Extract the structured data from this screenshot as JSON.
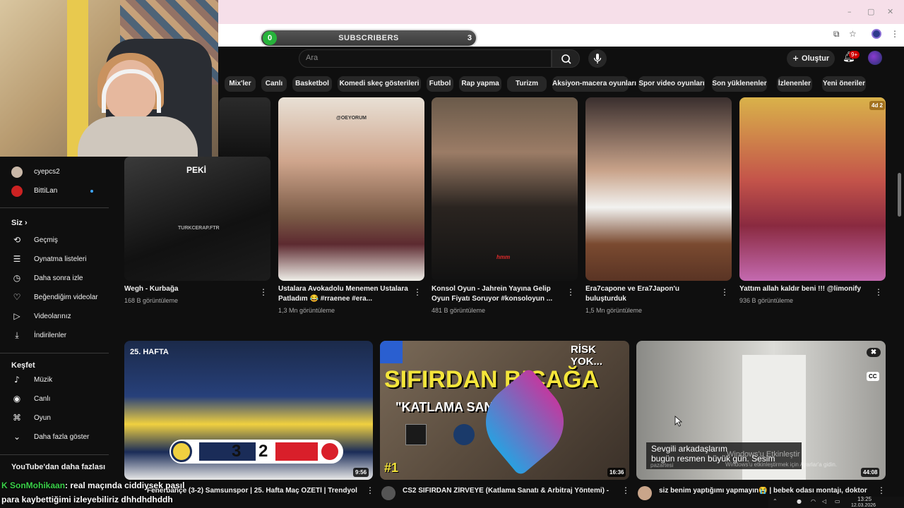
{
  "overlay": {
    "subs_current": "0",
    "subs_label": "SUBSCRIBERS",
    "subs_goal": "3"
  },
  "masthead": {
    "search_placeholder": "Ara",
    "create_label": "Oluştur",
    "notification_count": "9+"
  },
  "chips": [
    "Mix'ler",
    "Canlı",
    "Basketbol",
    "Komedi skeç gösterileri",
    "Futbol",
    "Rap yapma",
    "Turizm",
    "Aksiyon-macera oyunları",
    "Spor video oyunları",
    "Son yüklenenler",
    "İzlenenler",
    "Yeni öneriler"
  ],
  "sidebar": {
    "subscriptions": [
      {
        "label": "cyepcs2"
      },
      {
        "label": "BittiLan"
      }
    ],
    "you_header": "Siz",
    "you_items": [
      {
        "label": "Geçmiş",
        "icon": "history-icon"
      },
      {
        "label": "Oynatma listeleri",
        "icon": "playlist-icon"
      },
      {
        "label": "Daha sonra izle",
        "icon": "clock-icon"
      },
      {
        "label": "Beğendiğim videolar",
        "icon": "like-icon"
      },
      {
        "label": "Videolarınız",
        "icon": "video-icon"
      },
      {
        "label": "İndirilenler",
        "icon": "download-icon"
      }
    ],
    "explore_header": "Keşfet",
    "explore_items": [
      {
        "label": "Müzik",
        "icon": "music-icon"
      },
      {
        "label": "Canlı",
        "icon": "live-icon"
      },
      {
        "label": "Oyun",
        "icon": "gaming-icon"
      },
      {
        "label": "Daha fazla göster",
        "icon": "chevron-down-icon"
      }
    ],
    "more_header": "YouTube'dan daha fazlası"
  },
  "videos_row1": [
    {
      "title": "Wegh - Kurbağa",
      "views": "168 B görüntüleme",
      "overlay": "PEKİ",
      "watermark": "TURKCERAP.FTR"
    },
    {
      "title": "Ustalara Avokadolu Menemen Ustalara Patladım 😂 #rraenee #era...",
      "views": "1,3 Mn görüntüleme",
      "overlay": "@OEYORUM"
    },
    {
      "title": "Konsol Oyun - Jahrein Yayına Gelip Oyun Fiyatı Soruyor #konsoloyun ...",
      "views": "481 B görüntüleme",
      "overlay": "hmm"
    },
    {
      "title": "Era7capone ve Era7Japon'u buluşturduk",
      "views": "1,5 Mn görüntüleme"
    },
    {
      "title": "Yattım allah kaldır beni !!! @limonify",
      "views": "936 B görüntüleme",
      "badge": "4d 2"
    }
  ],
  "videos_row2": [
    {
      "duration": "9:56",
      "week": "25. HAFTA",
      "score_home": "3",
      "score_away": "2",
      "title": "Fenerbahçe (3-2) Samsunspor | 25. Hafta Maç ÖZETİ | Trendyol"
    },
    {
      "duration": "16:36",
      "headline": "SIFIRDAN BIÇAĞA",
      "subline": "\"KATLAMA SANATI V2\"",
      "corner": "RİSK YOK...",
      "rank": "#1",
      "title": "CS2 SIFIRDAN ZİRVEYE (Katlama Sanatı & Arbitraj Yöntemi) -"
    },
    {
      "duration": "44:08",
      "caption_line1": "Sevgili arkadaşlarım",
      "caption_line2": "bugün resmen büyük gün. Sesim",
      "cc": "CC",
      "title": "siz benim yaptığımı yapmayın😭 | bebek odası montajı, doktor"
    }
  ],
  "windows_watermark": {
    "line1": "Windows'u Etkinleştir",
    "line2": "Windows'u etkinleştirmek için Ayarlar'a gidin.",
    "line3": "pazartesi"
  },
  "chat": {
    "line1_prefix": "K",
    "line1_user": "SonMohikaan",
    "line1_text": "real maçında ciddiysek pasıl",
    "line2_text": "para kaybettiğimi izleyebiliriz dhhdhdhddh"
  },
  "clock": {
    "time": "13:25",
    "date": "12.03.2026"
  },
  "colors": {
    "bg": "#0f0f0f",
    "chip": "#272727",
    "accent_red": "#cc0000",
    "subs_green": "#27b33b"
  }
}
